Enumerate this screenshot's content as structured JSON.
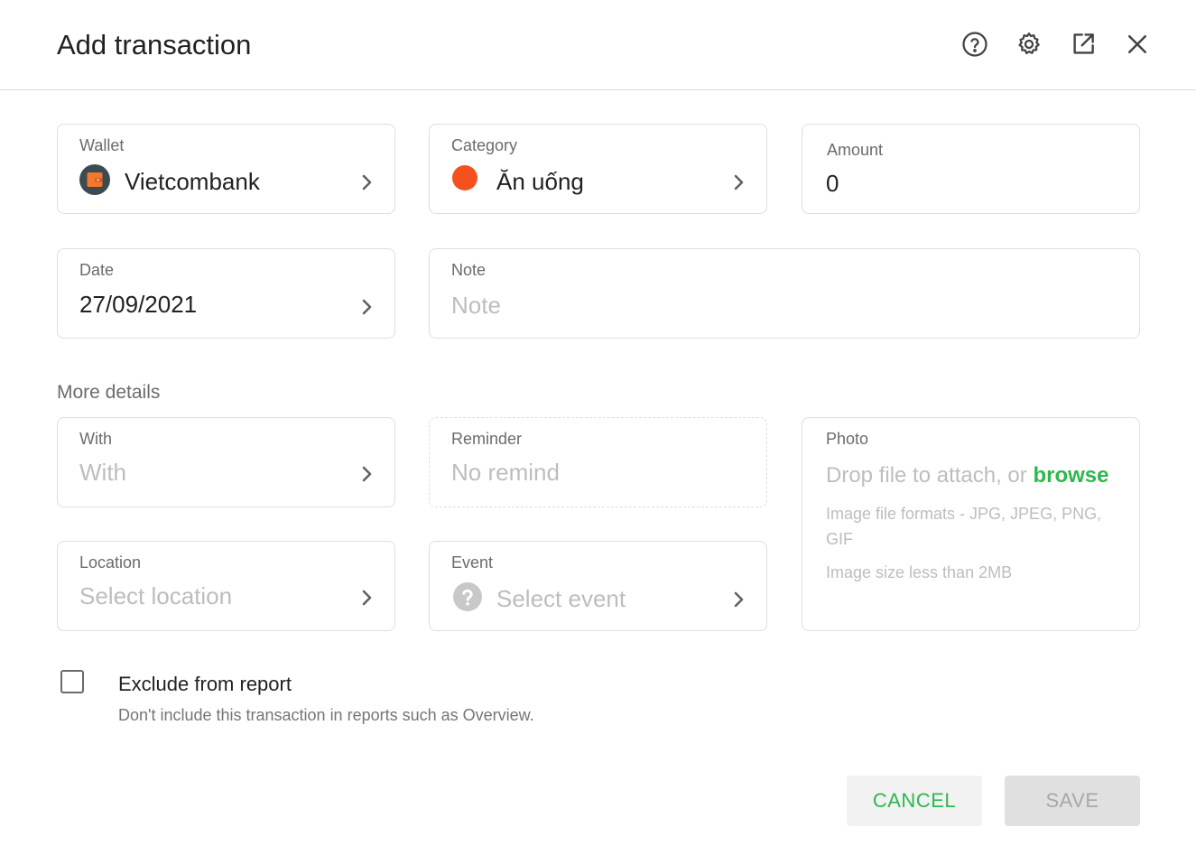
{
  "dialog": {
    "title": "Add transaction"
  },
  "header_icons": [
    "help-icon",
    "settings-icon",
    "open-external-icon",
    "close-icon"
  ],
  "wallet": {
    "label": "Wallet",
    "value": "Vietcombank"
  },
  "category": {
    "label": "Category",
    "value": "Ăn uống",
    "color": "#f4511e"
  },
  "amount": {
    "label": "Amount",
    "value": "0"
  },
  "date": {
    "label": "Date",
    "value": "27/09/2021"
  },
  "note": {
    "label": "Note",
    "placeholder": "Note"
  },
  "more_details": {
    "heading": "More details"
  },
  "with": {
    "label": "With",
    "placeholder": "With"
  },
  "reminder": {
    "label": "Reminder",
    "value": "No remind"
  },
  "photo": {
    "label": "Photo",
    "drop_text": "Drop file to attach, or ",
    "browse": "browse",
    "formats": "Image file formats - JPG, JPEG, PNG, GIF",
    "size": "Image size less than 2MB"
  },
  "location": {
    "label": "Location",
    "placeholder": "Select location"
  },
  "event": {
    "label": "Event",
    "placeholder": "Select event"
  },
  "exclude": {
    "title": "Exclude from report",
    "subtitle": "Don't include this transaction in reports such as Overview.",
    "checked": false
  },
  "buttons": {
    "cancel": "CANCEL",
    "save": "SAVE"
  },
  "colors": {
    "accent": "#2db84d",
    "border": "#dedede",
    "placeholder": "#bdbdbd"
  }
}
